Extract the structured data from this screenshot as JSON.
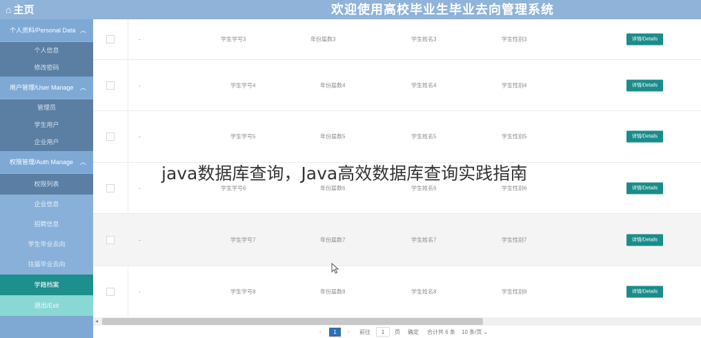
{
  "header": {
    "home_icon": "home-icon",
    "home_label": "主页",
    "system_title": "欢迎使用高校毕业生毕业去向管理系统"
  },
  "sidebar": {
    "groups": [
      {
        "label": "个人资料/Personal Data",
        "items": [
          "个人信息",
          "修改密码"
        ]
      },
      {
        "label": "用户管理/User Manage",
        "items": [
          "管理员",
          "学生用户",
          "企业用户"
        ]
      },
      {
        "label": "权限管理/Auth Manage",
        "items": [
          "权限列表",
          "企业信息",
          "招聘信息",
          "学生毕业去向",
          "往届毕业去向",
          "学籍档案"
        ]
      }
    ],
    "exit_label": "退出/Exit",
    "colors": {
      "group": "#7ea9d5",
      "sub_dark": "#5b7ea3",
      "active": "#1d8f8c"
    }
  },
  "table": {
    "rows": [
      {
        "dash": "-",
        "student_no": "学生学号3",
        "grade": "年份届数3",
        "name": "学生姓名3",
        "gender": "学生性别3",
        "shaded": false
      },
      {
        "dash": "-",
        "student_no": "学生学号4",
        "grade": "年份届数4",
        "name": "学生姓名4",
        "gender": "学生性别4",
        "shaded": false
      },
      {
        "dash": "-",
        "student_no": "学生学号5",
        "grade": "年份届数5",
        "name": "学生姓名5",
        "gender": "学生性别5",
        "shaded": false
      },
      {
        "dash": "-",
        "student_no": "学生学号6",
        "grade": "年份届数6",
        "name": "学生姓名6",
        "gender": "学生性别6",
        "shaded": false
      },
      {
        "dash": "-",
        "student_no": "学生学号7",
        "grade": "年份届数7",
        "name": "学生姓名7",
        "gender": "学生性别7",
        "shaded": true
      },
      {
        "dash": "-",
        "student_no": "学生学号8",
        "grade": "年份届数8",
        "name": "学生姓名8",
        "gender": "学生性别8",
        "shaded": false
      }
    ],
    "details_label": "详情/Details",
    "button_color": "#1a8c8a"
  },
  "pagination": {
    "prev_icon": "chevron-left-icon",
    "current_page": "1",
    "next_icon": "chevron-right-icon",
    "goto_label": "前往",
    "goto_value": "1",
    "page_unit": "页",
    "confirm_label": "确定",
    "total_label": "合计共 6 条",
    "page_size_label": "10 条/页"
  },
  "overlay": {
    "watermark": "java数据库查询，Java高效数据库查询实践指南"
  }
}
